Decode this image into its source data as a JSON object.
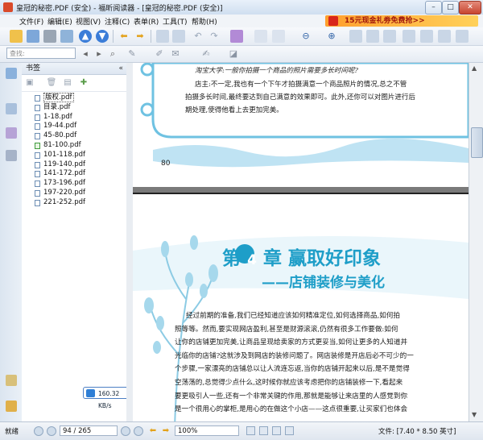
{
  "window": {
    "title": "皇冠的秘密.PDF (安全) - 福昕阅读器 - [皇冠的秘密.PDF (安全)]",
    "buttons": [
      "–",
      "□",
      "✕"
    ]
  },
  "menu": {
    "items": [
      "文件(F)",
      "编辑(E)",
      "视图(V)",
      "注释(C)",
      "表单(R)",
      "工具(T)",
      "帮助(H)"
    ],
    "promo": "15元现金礼劵免费抢>>"
  },
  "toolbar": {
    "search_placeholder": "查找:"
  },
  "bookmarks": {
    "header": "书签",
    "collapse_label": "«",
    "items": [
      {
        "label": "版权.pdf",
        "selected": true
      },
      {
        "label": "目录.pdf",
        "selected": false
      },
      {
        "label": "1-18.pdf",
        "selected": false
      },
      {
        "label": "19-44.pdf",
        "selected": false
      },
      {
        "label": "45-80.pdf",
        "selected": false
      },
      {
        "label": "81-100.pdf",
        "selected": false
      },
      {
        "label": "101-118.pdf",
        "selected": false
      },
      {
        "label": "119-140.pdf",
        "selected": false
      },
      {
        "label": "141-172.pdf",
        "selected": false
      },
      {
        "label": "173-196.pdf",
        "selected": false
      },
      {
        "label": "197-220.pdf",
        "selected": false
      },
      {
        "label": "221-252.pdf",
        "selected": false
      }
    ]
  },
  "speed_widget": {
    "label": "160.32 KB/s"
  },
  "document": {
    "page_top": {
      "question": "淘宝大学:一般你拍摄一个商品的照片需要多长时间呢?",
      "answer_lines": [
        "店主:不一定,我也有一个下午才拍摄满意一个商品照片的情况,总之不管",
        "拍摄多长时间,最终要达到自己满意的效果即可。此外,还你可以对图片进行后",
        "期处理,使得他看上去更加完美。"
      ],
      "page_number": "80"
    },
    "chapter": {
      "prefix": "第",
      "number": "4",
      "suffix": "章  赢取好印象",
      "subtitle": "——店铺装修与美化"
    },
    "body_lines": [
      "经过前期的准备,我们已经知道应该如何精准定位,如何选择商品,如何拍",
      "照等等。然而,要实现网店盈利,甚至是财源滚滚,仍然有很多工作要做:如何",
      "让你的店铺更加完美,让商品呈现给卖家的方式更妥当,如何让更多的人知道并",
      "光临你的店铺?这就涉及到网店的装修问题了。网店装修是开店后必不可少的一",
      "个步骤,一家漂亮的店铺总以让人流连忘返,当你的店铺开起来以后,是不是觉得",
      "空荡荡的,总觉得少点什么,这时候你就应该考虑把你的店铺装修一下,看起来",
      "要更吸引人一些,还有一个非常关键的作用,那就是能够让来店里的人感觉到你",
      "是一个很用心的掌柜,是用心的在做这个小店——这点很重要,让买家们也体会"
    ]
  },
  "status": {
    "ready": "就绪",
    "page_value": "94 / 265",
    "zoom_value": "100%",
    "doc_size": "文件: [7.40 * 8.50 英寸]"
  },
  "colors": {
    "accent_teal": "#1e9ec8",
    "chapter_circle": "#1e9ec8",
    "light_blue_wash": "#d4ecf6"
  }
}
